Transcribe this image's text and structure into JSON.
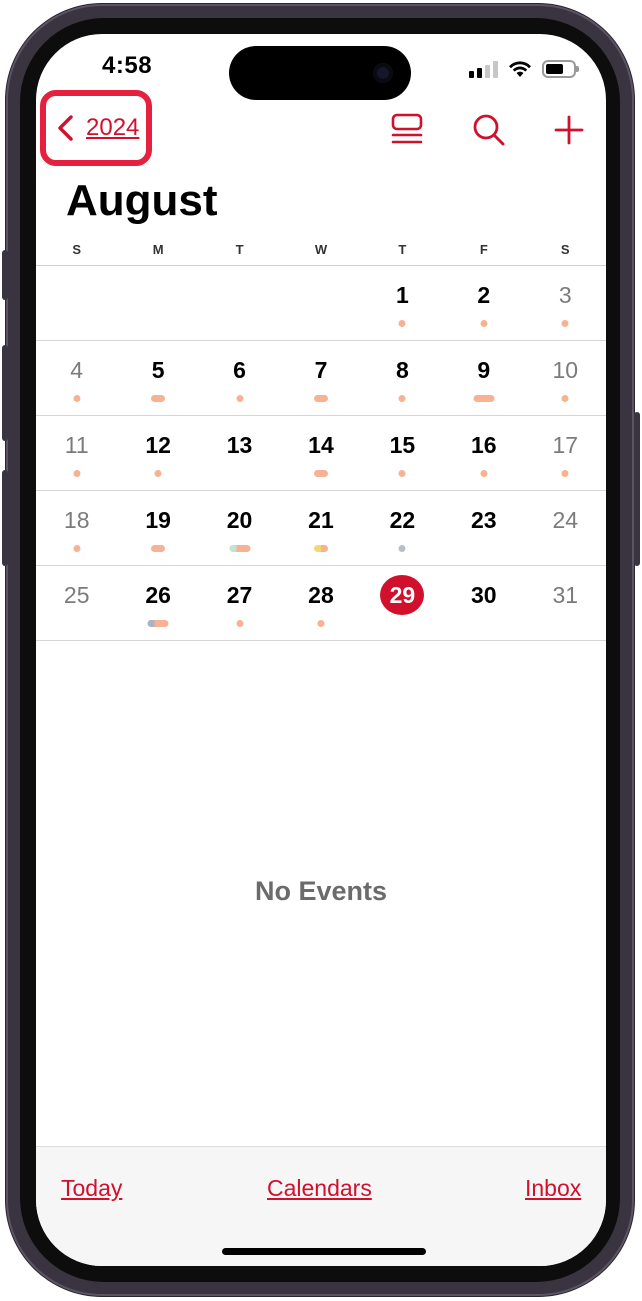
{
  "status": {
    "time": "4:58"
  },
  "nav": {
    "back_label": "2024"
  },
  "month": {
    "title": "August"
  },
  "weekdays": [
    "S",
    "M",
    "T",
    "W",
    "T",
    "F",
    "S"
  ],
  "weeks": [
    [
      {
        "day": "",
        "dots": []
      },
      {
        "day": "",
        "dots": []
      },
      {
        "day": "",
        "dots": []
      },
      {
        "day": "",
        "dots": []
      },
      {
        "day": "1",
        "dots": [
          "#f7b193"
        ]
      },
      {
        "day": "2",
        "dots": [
          "#f7b193"
        ]
      },
      {
        "day": "3",
        "dots": [
          "#f7b193"
        ],
        "weekend": true
      }
    ],
    [
      {
        "day": "4",
        "dots": [
          "#f7b193"
        ],
        "weekend": true
      },
      {
        "day": "5",
        "dots": [
          "#f7b193",
          "#f7b193"
        ]
      },
      {
        "day": "6",
        "dots": [
          "#f7b193"
        ]
      },
      {
        "day": "7",
        "dots": [
          "#f7b193",
          "#f7b193"
        ]
      },
      {
        "day": "8",
        "dots": [
          "#f7b193"
        ]
      },
      {
        "day": "9",
        "dots": [
          "#f7b193",
          "#f7b193",
          "#f7b193"
        ]
      },
      {
        "day": "10",
        "dots": [
          "#f7b193"
        ],
        "weekend": true
      }
    ],
    [
      {
        "day": "11",
        "dots": [
          "#f7b193"
        ],
        "weekend": true
      },
      {
        "day": "12",
        "dots": [
          "#f7b193"
        ]
      },
      {
        "day": "13",
        "dots": []
      },
      {
        "day": "14",
        "dots": [
          "#f7b193",
          "#f7b193"
        ]
      },
      {
        "day": "15",
        "dots": [
          "#f7b193"
        ]
      },
      {
        "day": "16",
        "dots": [
          "#f7b193"
        ]
      },
      {
        "day": "17",
        "dots": [
          "#f7b193"
        ],
        "weekend": true
      }
    ],
    [
      {
        "day": "18",
        "dots": [
          "#f7b193"
        ],
        "weekend": true
      },
      {
        "day": "19",
        "dots": [
          "#f7b193",
          "#f7b193"
        ]
      },
      {
        "day": "20",
        "dots": [
          "#bfe3d4",
          "#f7b193",
          "#f7b193"
        ]
      },
      {
        "day": "21",
        "dots": [
          "#f5d76e",
          "#f7b193"
        ]
      },
      {
        "day": "22",
        "dots": [
          "#b9bfca"
        ]
      },
      {
        "day": "23",
        "dots": []
      },
      {
        "day": "24",
        "dots": [],
        "weekend": true
      }
    ],
    [
      {
        "day": "25",
        "dots": [],
        "weekend": true
      },
      {
        "day": "26",
        "dots": [
          "#a9b3c2",
          "#f7b193",
          "#f7b193"
        ]
      },
      {
        "day": "27",
        "dots": [
          "#f7b193"
        ]
      },
      {
        "day": "28",
        "dots": [
          "#f7b193"
        ]
      },
      {
        "day": "29",
        "dots": [],
        "today": true
      },
      {
        "day": "30",
        "dots": []
      },
      {
        "day": "31",
        "dots": [],
        "weekend": true
      }
    ]
  ],
  "empty_state": "No Events",
  "bottom": {
    "today": "Today",
    "calendars": "Calendars",
    "inbox": "Inbox"
  },
  "colors": {
    "accent": "#d1102e",
    "highlight_box": "#e5213f",
    "event_dot": "#f7b193"
  }
}
